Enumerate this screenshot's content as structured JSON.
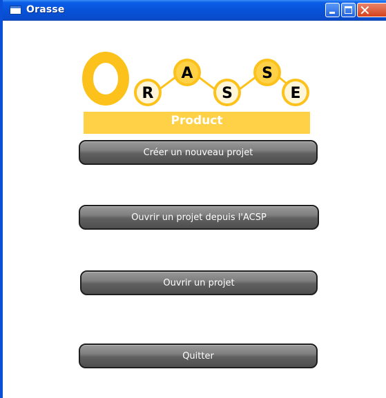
{
  "window": {
    "title": "Orasse",
    "icon": "app-window-icon",
    "controls": {
      "minimize_icon": "minimize-icon",
      "maximize_icon": "maximize-icon",
      "close_icon": "close-icon",
      "close_glyph": "✕"
    }
  },
  "logo": {
    "big_letter": "O",
    "letters": [
      "R",
      "A",
      "S",
      "S",
      "E"
    ],
    "tagline": "Product",
    "colors": {
      "accent": "#fcc21b",
      "band": "#fed147",
      "letter_fill_light": "#fff6da",
      "letter_fill_dark": "#fed147",
      "letter_text": "#000000"
    }
  },
  "menu": {
    "new_project": "Créer un nouveau projet",
    "open_from_acsp": "Ouvrir un projet depuis l'ACSP",
    "open_project": "Ouvrir un projet",
    "quit": "Quitter"
  }
}
